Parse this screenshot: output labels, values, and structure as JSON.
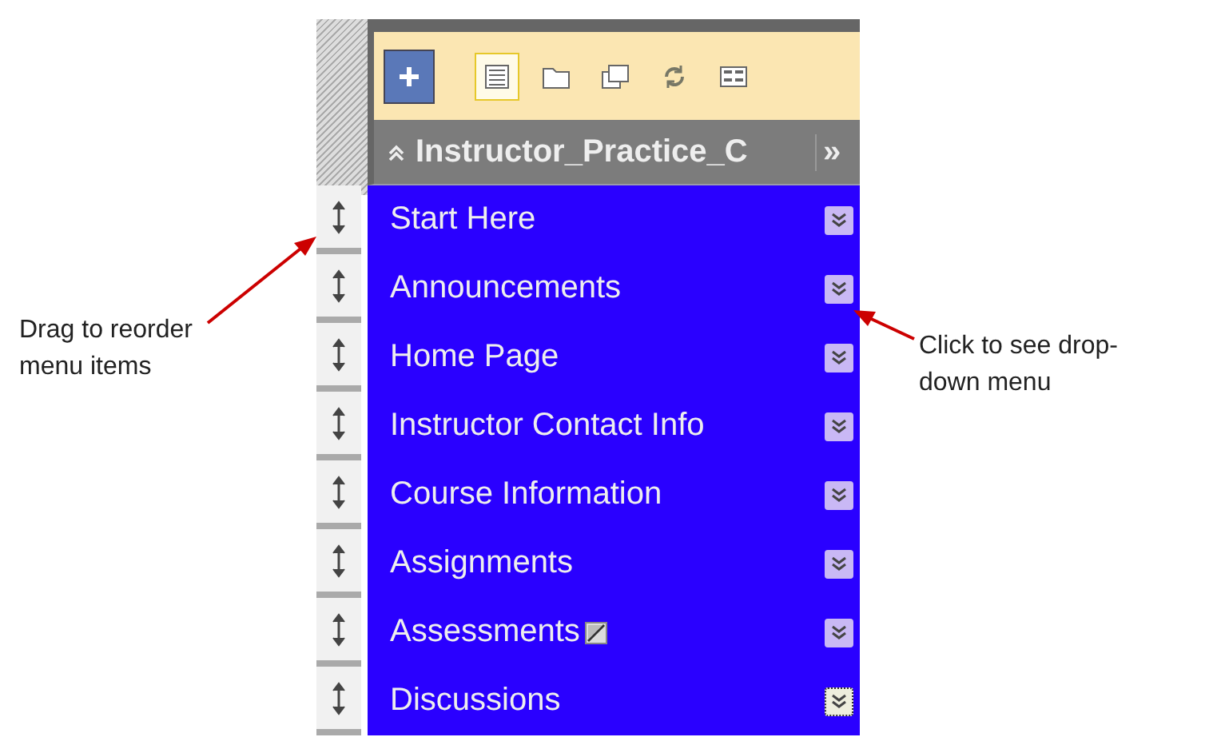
{
  "toolbar": {
    "tools": [
      {
        "kind": "list",
        "selected": true
      },
      {
        "kind": "folder",
        "selected": false
      },
      {
        "kind": "windows",
        "selected": false
      },
      {
        "kind": "refresh",
        "selected": false
      },
      {
        "kind": "grid",
        "selected": false
      }
    ]
  },
  "course_title": {
    "text": "Instructor_Practice_C",
    "expand": "»"
  },
  "menu_items": [
    {
      "label": "Start Here",
      "hidden": false,
      "focused": false
    },
    {
      "label": "Announcements",
      "hidden": false,
      "focused": false
    },
    {
      "label": "Home Page",
      "hidden": false,
      "focused": false
    },
    {
      "label": "Instructor Contact Info",
      "hidden": false,
      "focused": false
    },
    {
      "label": "Course Information",
      "hidden": false,
      "focused": false
    },
    {
      "label": "Assignments",
      "hidden": false,
      "focused": false
    },
    {
      "label": "Assessments",
      "hidden": true,
      "focused": false
    },
    {
      "label": "Discussions",
      "hidden": false,
      "focused": true
    }
  ],
  "callouts": [
    {
      "kind": "left",
      "text": "Drag to reorder menu items"
    },
    {
      "kind": "right",
      "text": "Click to see drop-down menu"
    }
  ]
}
